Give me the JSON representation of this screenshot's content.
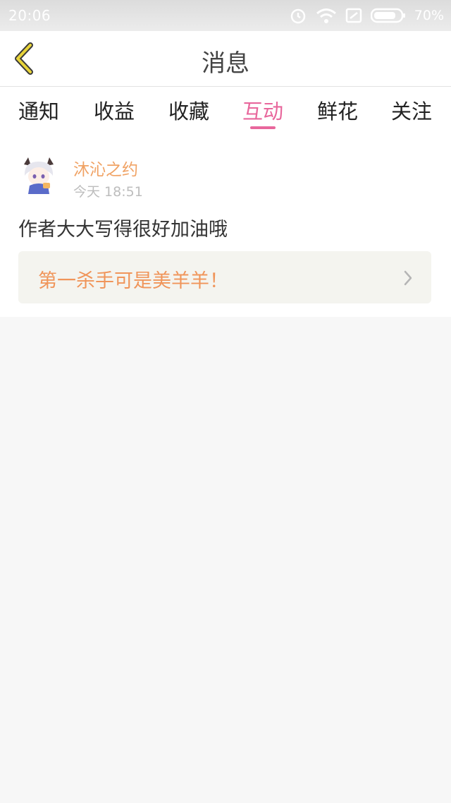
{
  "status_bar": {
    "time": "20:06",
    "battery": "70%",
    "icons": [
      "alarm-icon",
      "wifi-icon",
      "sim-icon",
      "battery-icon"
    ]
  },
  "header": {
    "title": "消息",
    "back_icon": "back-chevron-icon"
  },
  "tabs": [
    {
      "label": "通知",
      "active": false
    },
    {
      "label": "收益",
      "active": false
    },
    {
      "label": "收藏",
      "active": false
    },
    {
      "label": "互动",
      "active": true
    },
    {
      "label": "鲜花",
      "active": false
    },
    {
      "label": "关注",
      "active": false
    }
  ],
  "message": {
    "user_name": "沐沁之约",
    "time": "今天 18:51",
    "content": "作者大大写得很好加油哦",
    "quote": "第一杀手可是美羊羊！"
  },
  "colors": {
    "accent_pink": "#e8679c",
    "name_orange": "#f0a264",
    "quote_orange": "#f0955a",
    "back_yellow": "#e8d43a",
    "page_background": "#f7f7f7"
  }
}
